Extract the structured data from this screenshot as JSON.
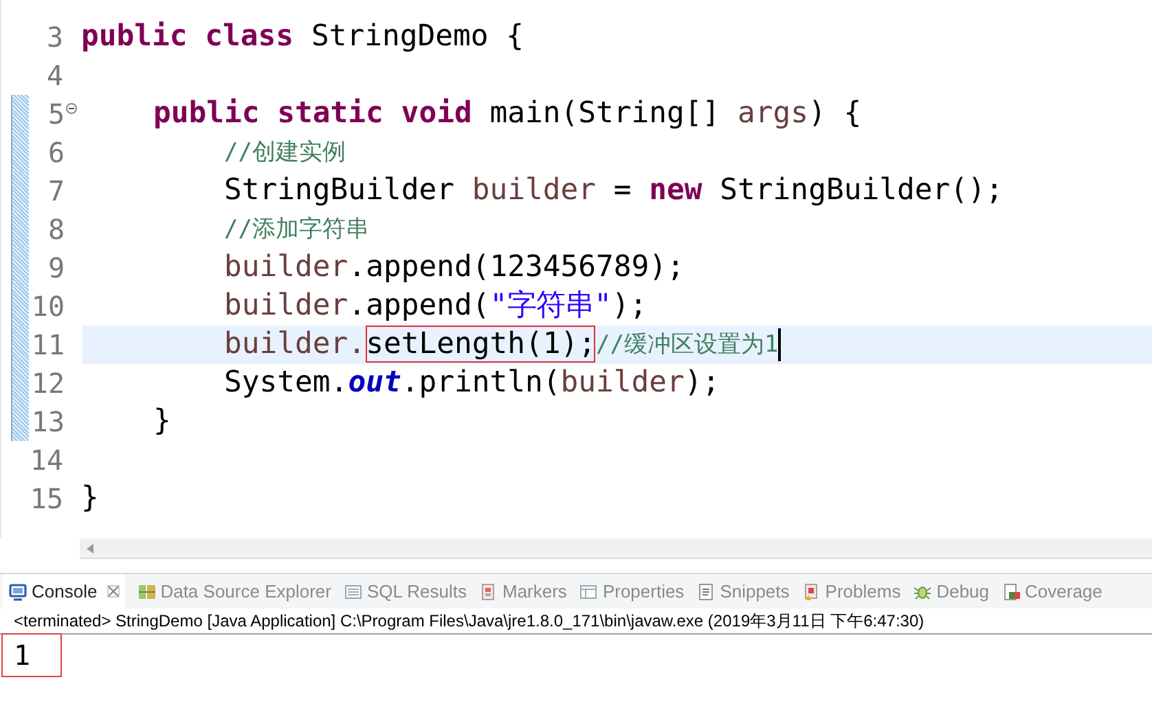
{
  "editor": {
    "lines": [
      {
        "number": "3",
        "changed": false,
        "collapsible": false,
        "current": false,
        "cursor": false,
        "tokens": [
          {
            "text": "public class",
            "kind": "keyword"
          },
          {
            "text": " StringDemo {",
            "kind": "plain"
          }
        ]
      },
      {
        "number": "4",
        "changed": false,
        "collapsible": false,
        "current": false,
        "cursor": false
      },
      {
        "number": "5",
        "changed": true,
        "collapsible": true,
        "current": false,
        "cursor": false,
        "tokens": [
          {
            "text": "    public static void",
            "kind": "keyword"
          },
          {
            "text": " main(String[] ",
            "kind": "plain"
          },
          {
            "text": "args",
            "kind": "variable"
          },
          {
            "text": ") {",
            "kind": "plain"
          }
        ]
      },
      {
        "number": "6",
        "changed": true,
        "collapsible": false,
        "current": false,
        "cursor": false,
        "tokens": [
          {
            "text": "        //创建实例",
            "kind": "comment"
          }
        ]
      },
      {
        "number": "7",
        "changed": true,
        "collapsible": false,
        "current": false,
        "cursor": false,
        "tokens": [
          {
            "text": "        StringBuilder ",
            "kind": "plain"
          },
          {
            "text": "builder",
            "kind": "variable"
          },
          {
            "text": " = ",
            "kind": "plain"
          },
          {
            "text": "new",
            "kind": "keyword"
          },
          {
            "text": " StringBuilder();",
            "kind": "plain"
          }
        ]
      },
      {
        "number": "8",
        "changed": true,
        "collapsible": false,
        "current": false,
        "cursor": false,
        "tokens": [
          {
            "text": "        //添加字符串",
            "kind": "comment"
          }
        ]
      },
      {
        "number": "9",
        "changed": true,
        "collapsible": false,
        "current": false,
        "cursor": false,
        "tokens": [
          {
            "text": "        builder",
            "kind": "variable"
          },
          {
            "text": ".append(123456789);",
            "kind": "plain"
          }
        ]
      },
      {
        "number": "10",
        "changed": true,
        "collapsible": false,
        "current": false,
        "cursor": false,
        "tokens": [
          {
            "text": "        builder",
            "kind": "variable"
          },
          {
            "text": ".append(",
            "kind": "plain"
          },
          {
            "text": "\"字符串\"",
            "kind": "string"
          },
          {
            "text": ");",
            "kind": "plain"
          }
        ]
      },
      {
        "number": "11",
        "changed": true,
        "collapsible": false,
        "current": true,
        "cursor": true,
        "tokens": [
          {
            "text": "        builder.",
            "kind": "variable"
          },
          {
            "text": "setLength(1);",
            "kind": "boxed"
          },
          {
            "text": "//缓冲区设置为1",
            "kind": "comment"
          }
        ]
      },
      {
        "number": "12",
        "changed": true,
        "collapsible": false,
        "current": false,
        "cursor": false,
        "tokens": [
          {
            "text": "        System.",
            "kind": "plain"
          },
          {
            "text": "out",
            "kind": "field"
          },
          {
            "text": ".println(",
            "kind": "plain"
          },
          {
            "text": "builder",
            "kind": "variable"
          },
          {
            "text": ");",
            "kind": "plain"
          }
        ]
      },
      {
        "number": "13",
        "changed": true,
        "collapsible": false,
        "current": false,
        "cursor": false,
        "tokens": [
          {
            "text": "    }",
            "kind": "plain"
          }
        ]
      },
      {
        "number": "14",
        "changed": false,
        "collapsible": false,
        "current": false,
        "cursor": false
      },
      {
        "number": "15",
        "changed": false,
        "collapsible": false,
        "current": false,
        "cursor": false,
        "tokens": [
          {
            "text": "}",
            "kind": "plain"
          }
        ]
      }
    ]
  },
  "panel": {
    "tabs": [
      {
        "label": "Console",
        "selected": true
      },
      {
        "label": "Data Source Explorer",
        "selected": false
      },
      {
        "label": "SQL Results",
        "selected": false
      },
      {
        "label": "Markers",
        "selected": false
      },
      {
        "label": "Properties",
        "selected": false
      },
      {
        "label": "Snippets",
        "selected": false
      },
      {
        "label": "Problems",
        "selected": false
      },
      {
        "label": "Debug",
        "selected": false
      },
      {
        "label": "Coverage",
        "selected": false
      }
    ],
    "console_header": "<terminated> StringDemo [Java Application] C:\\Program Files\\Java\\jre1.8.0_171\\bin\\javaw.exe (2019年3月11日 下午6:47:30)",
    "output": [
      {
        "text": "1",
        "boxed": true
      }
    ]
  }
}
